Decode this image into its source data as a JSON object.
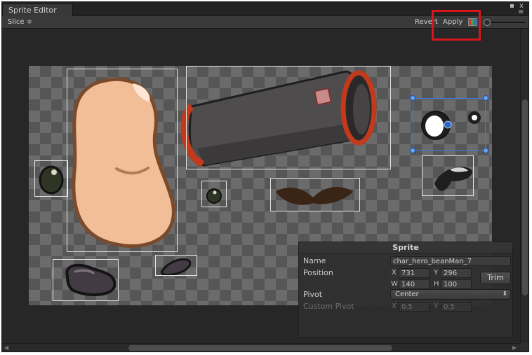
{
  "window": {
    "tab_title": "Sprite Editor",
    "menu_glyph": "≡",
    "close_glyph": "x",
    "lock_glyph": "▪"
  },
  "toolbar": {
    "slice_label": "Slice ≑",
    "revert_label": "Revert",
    "apply_label": "Apply",
    "color_toggle_icon": "rgb-channel-icon",
    "highlight_color": "#d6161c"
  },
  "canvas": {
    "checker_light": "#6b6b6b",
    "checker_dark": "#565656",
    "selection_color": "#3b7de0"
  },
  "sprite_panel": {
    "title": "Sprite",
    "name_label": "Name",
    "name_value": "char_hero_beanMan_7",
    "position_label": "Position",
    "x_label": "X",
    "x_value": "731",
    "y_label": "Y",
    "y_value": "296",
    "w_label": "W",
    "w_value": "140",
    "h_label": "H",
    "h_value": "100",
    "trim_label": "Trim",
    "pivot_label": "Pivot",
    "pivot_value": "Center",
    "custom_pivot_label": "Custom Pivot",
    "cx_label": "X",
    "cx_value": "0.5",
    "cy_label": "Y",
    "cy_value": "0.5"
  }
}
